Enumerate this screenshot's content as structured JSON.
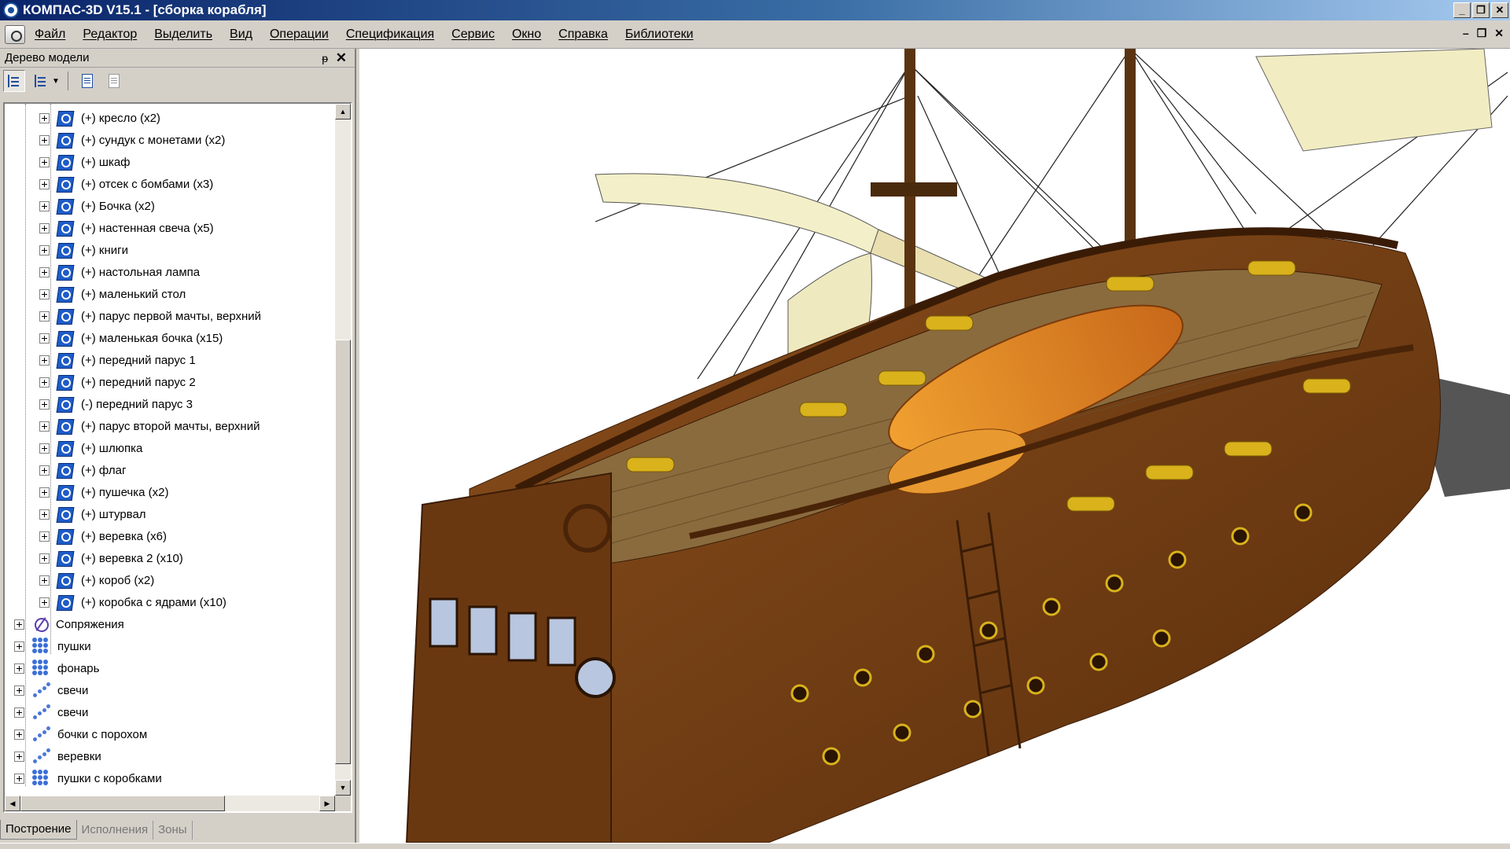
{
  "window": {
    "title": "КОМПАС-3D V15.1 - [сборка корабля]",
    "controls": [
      "_",
      "❐",
      "✕"
    ]
  },
  "menu": {
    "items": [
      "Файл",
      "Редактор",
      "Выделить",
      "Вид",
      "Операции",
      "Спецификация",
      "Сервис",
      "Окно",
      "Справка",
      "Библиотеки"
    ],
    "mdi_controls": [
      "–",
      "❐",
      "✕"
    ]
  },
  "panel": {
    "title": "Дерево модели",
    "pin": "ᵽ",
    "close": "✕",
    "tree": {
      "components": [
        "(+) кресло (x2)",
        "(+) сундук с монетами (x2)",
        "(+) шкаф",
        "(+) отсек с бомбами (x3)",
        "(+) Бочка (x2)",
        "(+) настенная свеча (x5)",
        "(+) книги",
        "(+) настольная лампа",
        "(+) маленький стол",
        "(+) парус первой мачты, верхний",
        "(+) маленькая бочка (x15)",
        "(+) передний парус 1",
        "(+) передний парус 2",
        "(-) передний парус 3",
        "(+) парус второй мачты, верхний",
        "(+) шлюпка",
        "(+) флаг",
        "(+) пушечка (x2)",
        "(+) штурвал",
        "(+) веревка (x6)",
        "(+) веревка 2 (x10)",
        "(+) короб (x2)",
        "(+) коробка с ядрами (x10)"
      ],
      "groups": [
        {
          "label": "Сопряжения",
          "icon": "mate-icon"
        },
        {
          "label": "пушки",
          "icon": "array-icon"
        },
        {
          "label": "фонарь",
          "icon": "array-icon"
        },
        {
          "label": "свечи",
          "icon": "curve-array-icon"
        },
        {
          "label": "свечи",
          "icon": "curve-array-icon"
        },
        {
          "label": "бочки с порохом",
          "icon": "curve-array-icon"
        },
        {
          "label": "веревки",
          "icon": "curve-array-icon"
        },
        {
          "label": "пушки с коробками",
          "icon": "array-icon"
        }
      ]
    },
    "tabs": [
      "Построение",
      "Исполнения",
      "Зоны"
    ]
  },
  "viewport": {
    "content": "3d-ship-assembly",
    "colors": {
      "hull": "#7a4418",
      "deck": "#8a6b3e",
      "sail": "#f1ecc2",
      "cannon": "#d9b21c",
      "boat": "#e08a1a"
    }
  }
}
